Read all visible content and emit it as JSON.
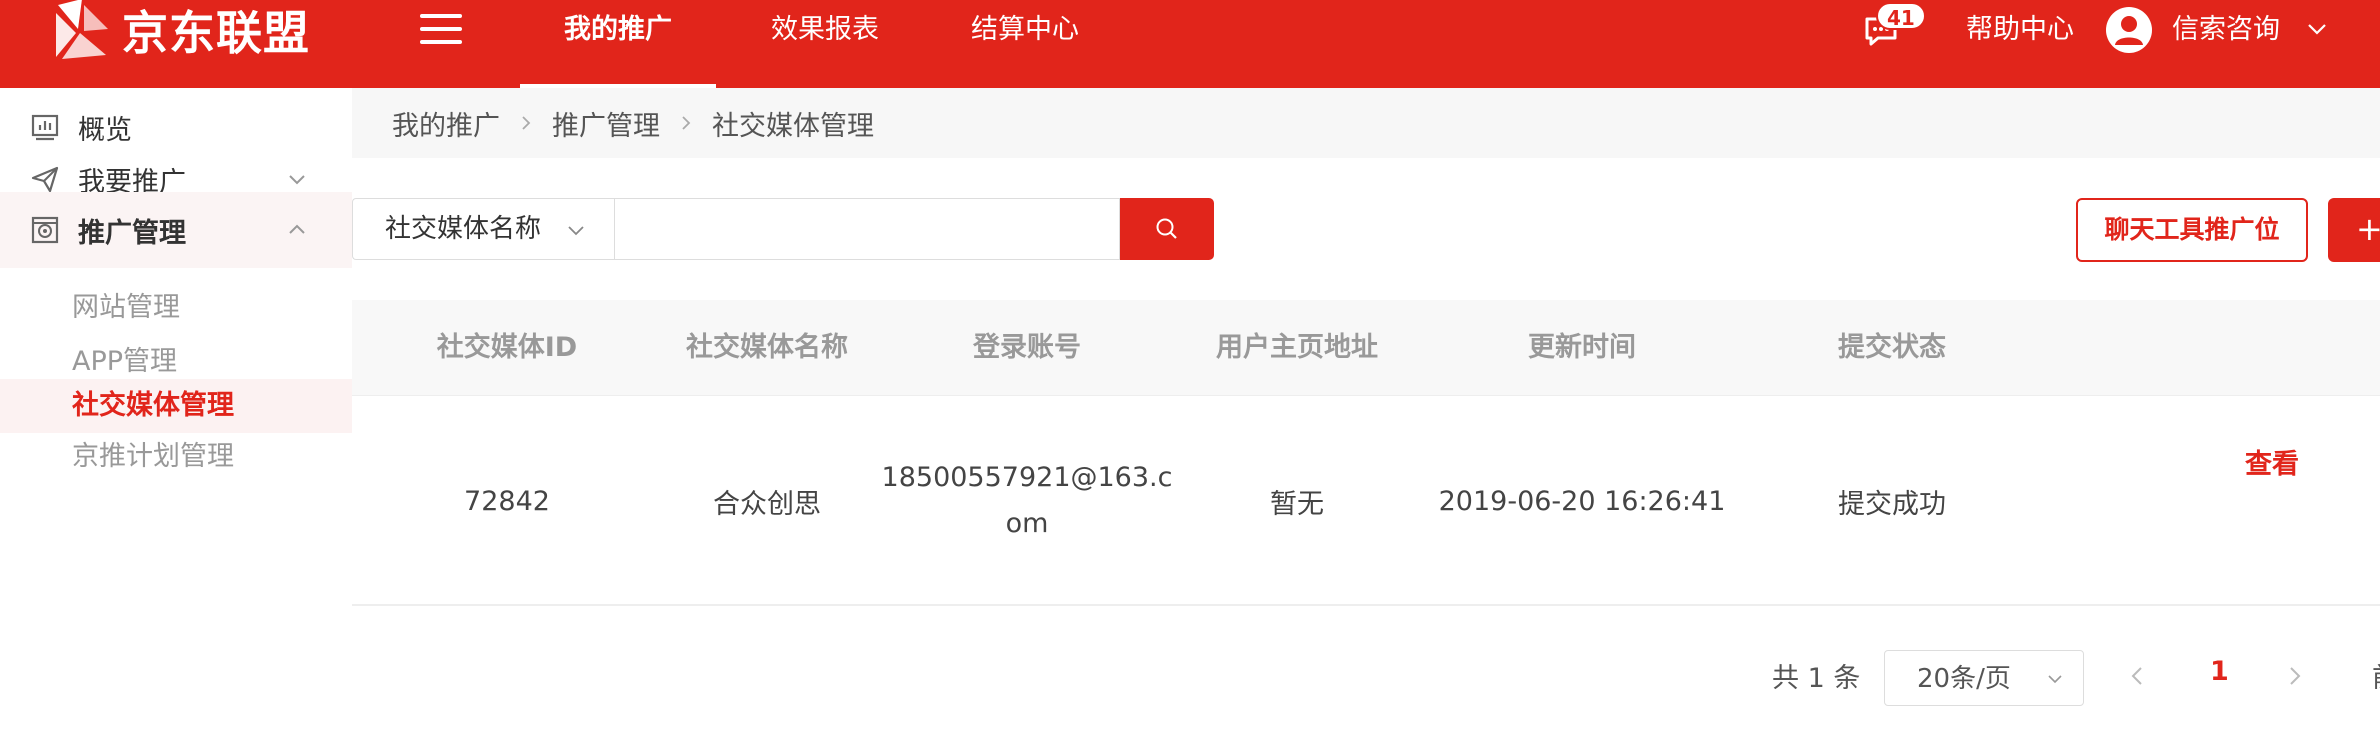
{
  "header": {
    "brand": "京东联盟",
    "nav": [
      {
        "label": "我的推广",
        "active": true
      },
      {
        "label": "效果报表",
        "active": false
      },
      {
        "label": "结算中心",
        "active": false
      }
    ],
    "message_count": "41",
    "help": "帮助中心",
    "user_name": "信索咨询",
    "brand_color": "#e1251b"
  },
  "sidebar": {
    "items": [
      {
        "label": "概览",
        "icon": "chart-icon"
      },
      {
        "label": "我要推广",
        "icon": "paper-plane-icon"
      },
      {
        "label": "推广管理",
        "icon": "manage-icon"
      }
    ],
    "sub_items": [
      {
        "label": "网站管理"
      },
      {
        "label": "APP管理"
      },
      {
        "label": "社交媒体管理",
        "active": true
      },
      {
        "label": "京推计划管理"
      }
    ]
  },
  "breadcrumb": [
    "我的推广",
    "推广管理",
    "社交媒体管理"
  ],
  "filter": {
    "select_value": "社交媒体名称",
    "search_value": "",
    "buttons": {
      "chat_tool": "聊天工具推广位",
      "add": "+"
    }
  },
  "table": {
    "columns": [
      "社交媒体ID",
      "社交媒体名称",
      "登录账号",
      "用户主页地址",
      "更新时间",
      "提交状态"
    ],
    "rows": [
      {
        "id": "72842",
        "name": "合众创思",
        "account_line1": "18500557921@163.c",
        "account_line2": "om",
        "homepage": "暂无",
        "updated": "2019-06-20 16:26:41",
        "status": "提交成功",
        "action": "查看"
      }
    ]
  },
  "pagination": {
    "total": "共 1 条",
    "page_size": "20条/页",
    "current_page": "1",
    "edge_text": "前"
  }
}
